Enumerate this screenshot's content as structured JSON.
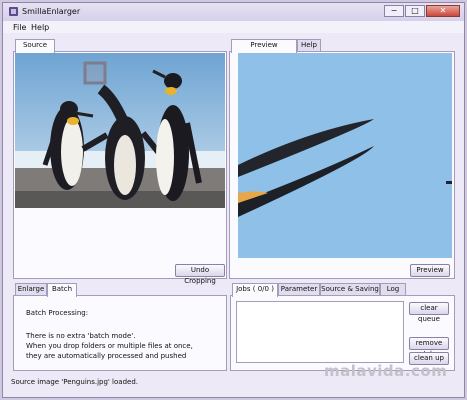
{
  "window": {
    "title": "SmillaEnlarger",
    "controls": [
      "−",
      "□",
      "✕"
    ]
  },
  "menu": [
    "File",
    "Help"
  ],
  "left_tabs": [
    "Source"
  ],
  "right_tabs": [
    "Preview",
    "Help"
  ],
  "buttons": {
    "undo_cropping": "Undo Cropping",
    "preview": "Preview",
    "clear_queue": "clear queue",
    "remove_job": "remove Job",
    "clean_up": "clean up"
  },
  "bottom_left_tabs": [
    "Enlarge",
    "Batch"
  ],
  "batch_text": [
    "Batch Processing:",
    "There is no extra 'batch mode'.",
    "When you drop folders or multiple files at once,",
    "they are automatically processed and pushed"
  ],
  "bottom_right_tabs": [
    "Jobs ( 0/0 )",
    "Parameter",
    "Source & Saving",
    "Log"
  ],
  "status": "Source image 'Penguins.jpg' loaded.",
  "watermark": "malavida.com",
  "icons": {
    "app": "smilla-app-icon",
    "minimize": "minimize-icon",
    "maximize": "maximize-icon",
    "close": "close-icon"
  },
  "colors": {
    "accent": "#c9493c",
    "sky": "#7fb3da",
    "preview_bg": "#8fc0e8"
  }
}
